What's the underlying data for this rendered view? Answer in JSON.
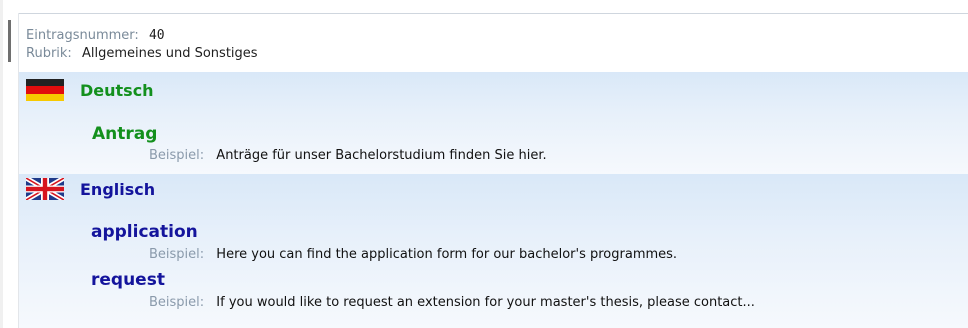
{
  "entry": {
    "number_label": "Eintragsnummer:",
    "number_value": "40",
    "category_label": "Rubrik:",
    "category_value": "Allgemeines und Sonstiges"
  },
  "languages": [
    {
      "name": "Deutsch",
      "flag_icon": "germany-flag-icon",
      "color": "#13901d",
      "terms": [
        {
          "term": "Antrag",
          "example_label": "Beispiel:",
          "example": "Anträge für unser Bachelorstudium finden Sie hier."
        }
      ]
    },
    {
      "name": "Englisch",
      "flag_icon": "uk-flag-icon",
      "color": "#14149c",
      "terms": [
        {
          "term": "application",
          "example_label": "Beispiel:",
          "example": "Here you can find the application form for our bachelor's programmes."
        },
        {
          "term": "request",
          "example_label": "Beispiel:",
          "example": "If you would like to request an extension for your master's thesis, please contact..."
        }
      ]
    }
  ]
}
